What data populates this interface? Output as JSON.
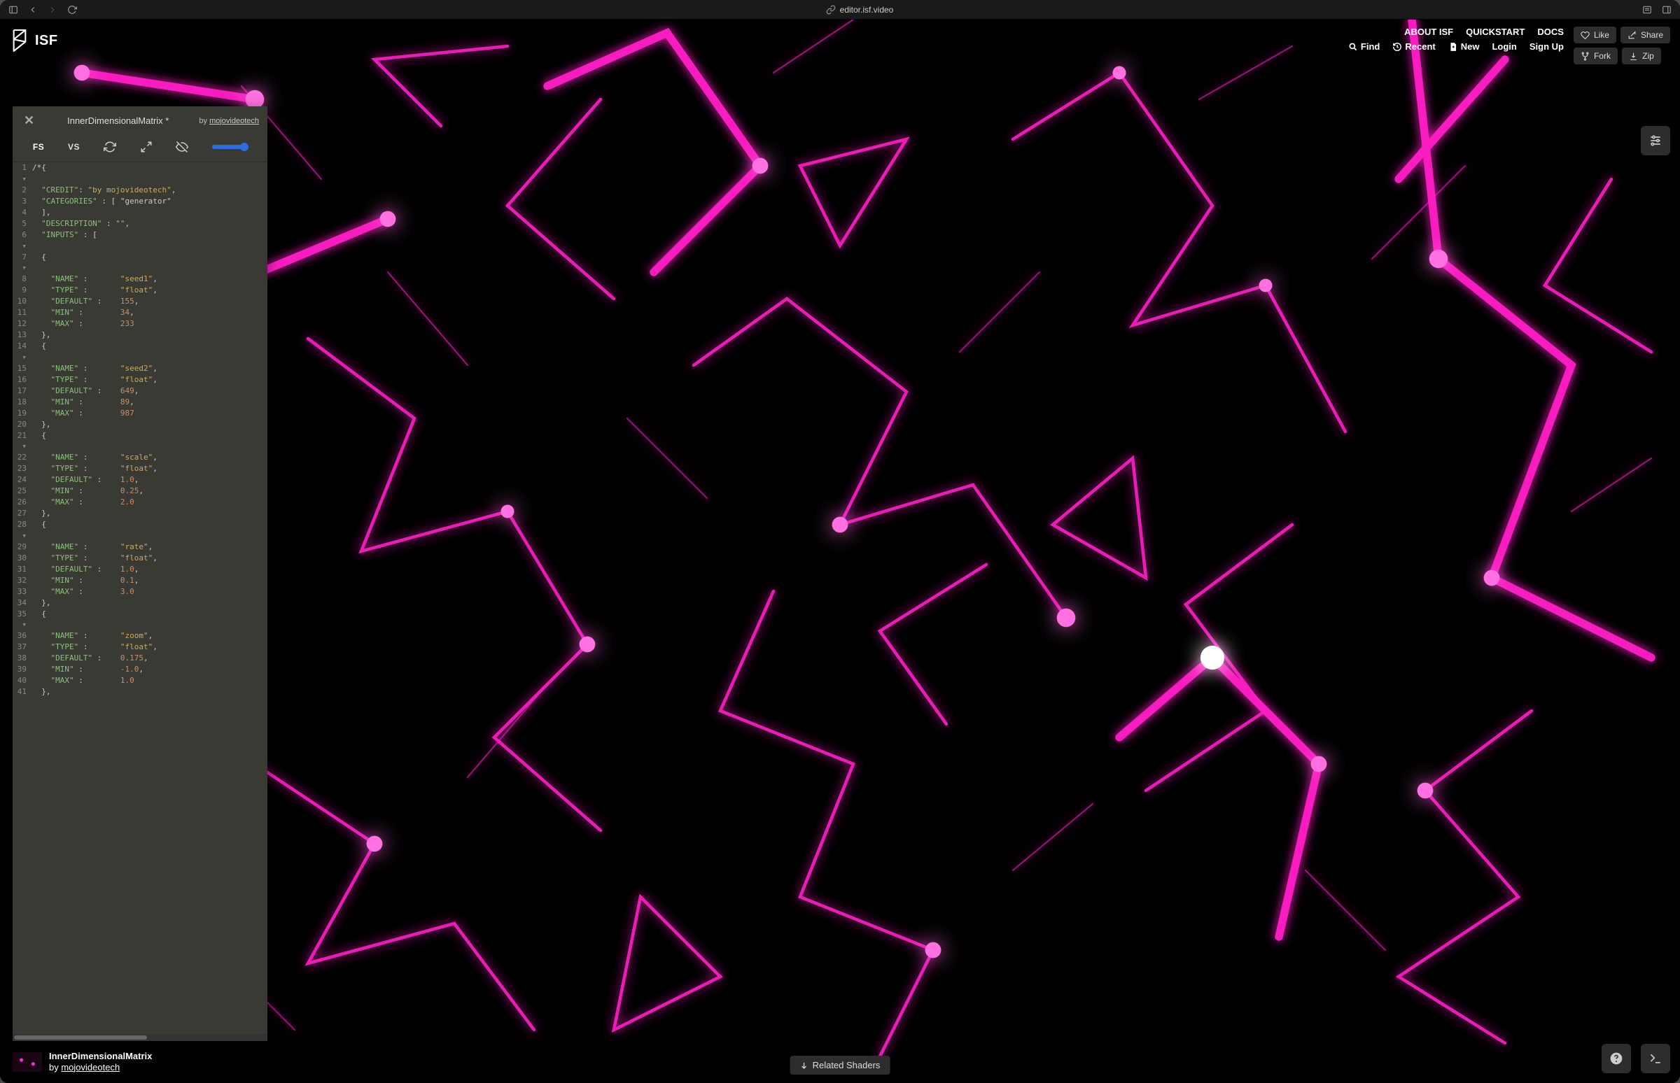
{
  "browser": {
    "url": "editor.isf.video"
  },
  "brand": "ISF",
  "nav": {
    "top": {
      "about": "ABOUT ISF",
      "quickstart": "QUICKSTART",
      "docs": "DOCS"
    },
    "bottom": {
      "find": "Find",
      "recent": "Recent",
      "new": "New",
      "login": "Login",
      "signup": "Sign Up"
    }
  },
  "actions": {
    "like": "Like",
    "share": "Share",
    "fork": "Fork",
    "zip": "Zip"
  },
  "editor": {
    "title": "InnerDimensionalMatrix *",
    "by_prefix": "by ",
    "author": "mojovideotech",
    "tabs": {
      "fs": "FS",
      "vs": "VS"
    },
    "code_lines": [
      "/*{",
      "  \"CREDIT\": \"by mojovideotech\",",
      "  \"CATEGORIES\" : [ \"generator\"",
      "  ],",
      "  \"DESCRIPTION\" : \"\",",
      "  \"INPUTS\" : [",
      "  {",
      "    \"NAME\" :       \"seed1\",",
      "    \"TYPE\" :       \"float\",",
      "    \"DEFAULT\" :    155,",
      "    \"MIN\" :        34,",
      "    \"MAX\" :        233",
      "  },",
      "  {",
      "    \"NAME\" :       \"seed2\",",
      "    \"TYPE\" :       \"float\",",
      "    \"DEFAULT\" :    649,",
      "    \"MIN\" :        89,",
      "    \"MAX\" :        987",
      "  },",
      "  {",
      "    \"NAME\" :       \"scale\",",
      "    \"TYPE\" :       \"float\",",
      "    \"DEFAULT\" :    1.0,",
      "    \"MIN\" :        0.25,",
      "    \"MAX\" :        2.0",
      "  },",
      "  {",
      "    \"NAME\" :       \"rate\",",
      "    \"TYPE\" :       \"float\",",
      "    \"DEFAULT\" :    1.0,",
      "    \"MIN\" :        0.1,",
      "    \"MAX\" :        3.0",
      "  },",
      "  {",
      "    \"NAME\" :       \"zoom\",",
      "    \"TYPE\" :       \"float\",",
      "    \"DEFAULT\" :    0.175,",
      "    \"MIN\" :        -1.0,",
      "    \"MAX\" :        1.0",
      "  },"
    ],
    "fold_markers": [
      1,
      6,
      7,
      14,
      21,
      28,
      35
    ]
  },
  "footer": {
    "shader_name": "InnerDimensionalMatrix",
    "by_prefix": "by ",
    "author": "mojovideotech",
    "related": "Related Shaders"
  }
}
